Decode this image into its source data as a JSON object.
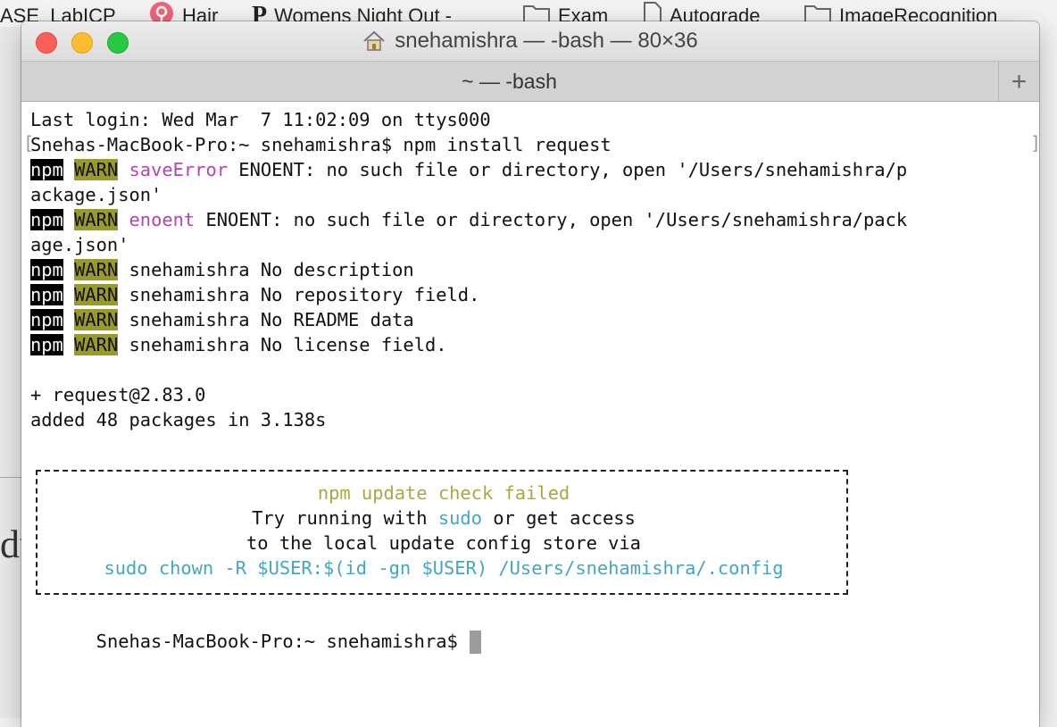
{
  "bookmarks": [
    {
      "label": "ASE_LabICP",
      "icon": "none"
    },
    {
      "label": "Hair",
      "icon": "pin-icon"
    },
    {
      "label": "Womens Night Out -",
      "icon": "p-logo-icon"
    },
    {
      "label": "Exam",
      "icon": "folder-icon"
    },
    {
      "label": "Autograde",
      "icon": "document-icon"
    },
    {
      "label": "ImageRecognition",
      "icon": "folder-icon"
    }
  ],
  "background_page": {
    "glyph": "du"
  },
  "window": {
    "title": "snehamishra — -bash — 80×36",
    "tab_label": "~ — -bash",
    "new_tab_label": "+"
  },
  "terminal": {
    "lines": [
      {
        "segments": [
          {
            "text": "Last login: Wed Mar  7 11:02:09 on ttys000"
          }
        ]
      },
      {
        "segments": [
          {
            "text": "Snehas-MacBook-Pro:~ snehamishra$ npm install request"
          }
        ]
      },
      {
        "segments": [
          {
            "text": "npm",
            "style": "npm"
          },
          {
            "text": " "
          },
          {
            "text": "WARN",
            "style": "warn"
          },
          {
            "text": " "
          },
          {
            "text": "saveError",
            "style": "mag"
          },
          {
            "text": " ENOENT: no such file or directory, open '/Users/snehamishra/p"
          }
        ]
      },
      {
        "segments": [
          {
            "text": "ackage.json'"
          }
        ]
      },
      {
        "segments": [
          {
            "text": "npm",
            "style": "npm"
          },
          {
            "text": " "
          },
          {
            "text": "WARN",
            "style": "warn"
          },
          {
            "text": " "
          },
          {
            "text": "enoent",
            "style": "mag"
          },
          {
            "text": " ENOENT: no such file or directory, open '/Users/snehamishra/pack"
          }
        ]
      },
      {
        "segments": [
          {
            "text": "age.json'"
          }
        ]
      },
      {
        "segments": [
          {
            "text": "npm",
            "style": "npm"
          },
          {
            "text": " "
          },
          {
            "text": "WARN",
            "style": "warn"
          },
          {
            "text": " snehamishra No description"
          }
        ]
      },
      {
        "segments": [
          {
            "text": "npm",
            "style": "npm"
          },
          {
            "text": " "
          },
          {
            "text": "WARN",
            "style": "warn"
          },
          {
            "text": " snehamishra No repository field."
          }
        ]
      },
      {
        "segments": [
          {
            "text": "npm",
            "style": "npm"
          },
          {
            "text": " "
          },
          {
            "text": "WARN",
            "style": "warn"
          },
          {
            "text": " snehamishra No README data"
          }
        ]
      },
      {
        "segments": [
          {
            "text": "npm",
            "style": "npm"
          },
          {
            "text": " "
          },
          {
            "text": "WARN",
            "style": "warn"
          },
          {
            "text": " snehamishra No license field."
          }
        ]
      },
      {
        "segments": [
          {
            "text": ""
          }
        ]
      },
      {
        "segments": [
          {
            "text": "+ request@2.83.0"
          }
        ]
      },
      {
        "segments": [
          {
            "text": "added 48 packages in 3.138s"
          }
        ]
      }
    ],
    "update_box": [
      {
        "segments": [
          {
            "text": "npm update check failed",
            "style": "yel"
          }
        ]
      },
      {
        "segments": [
          {
            "text": "Try running with "
          },
          {
            "text": "sudo",
            "style": "cyan"
          },
          {
            "text": " or get access"
          }
        ]
      },
      {
        "segments": [
          {
            "text": "to the local update config store via"
          }
        ]
      },
      {
        "segments": [
          {
            "text": "sudo chown -R $USER:$(id -gn $USER) /Users/snehamishra/.config",
            "style": "cyan"
          }
        ]
      }
    ],
    "prompt": "Snehas-MacBook-Pro:~ snehamishra$ "
  },
  "colors": {
    "warn_bg": "#9a9a2a",
    "npm_bg": "#000000",
    "magenta": "#b444b4",
    "yellow": "#a8a848",
    "cyan": "#45a6bf"
  }
}
